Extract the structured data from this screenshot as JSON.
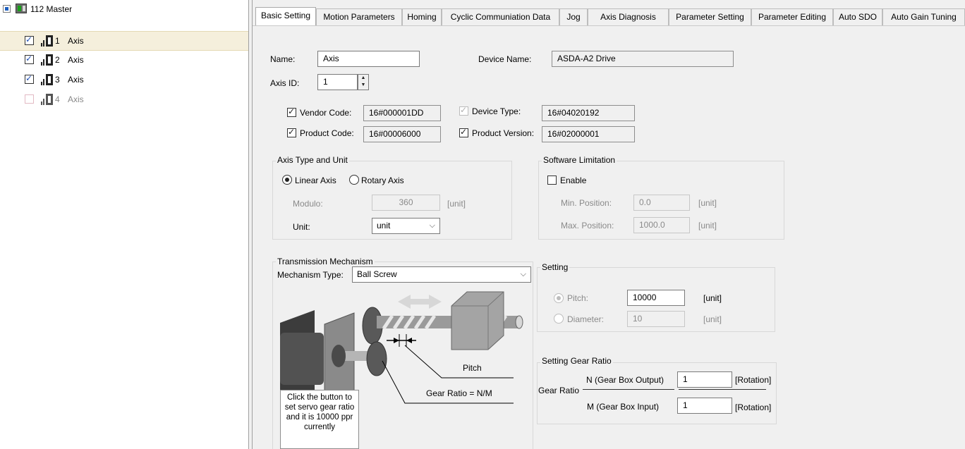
{
  "tree": {
    "master": {
      "label": "112 Master"
    },
    "axes": [
      {
        "num": "1",
        "label": "Axis",
        "checked": true,
        "selected": true,
        "enabled": true
      },
      {
        "num": "2",
        "label": "Axis",
        "checked": true,
        "selected": false,
        "enabled": true
      },
      {
        "num": "3",
        "label": "Axis",
        "checked": true,
        "selected": false,
        "enabled": true
      },
      {
        "num": "4",
        "label": "Axis",
        "checked": false,
        "selected": false,
        "enabled": false
      }
    ]
  },
  "tabs": [
    "Basic Setting",
    "Motion Parameters",
    "Homing",
    "Cyclic Communiation Data",
    "Jog",
    "Axis Diagnosis",
    "Parameter Setting",
    "Parameter Editing",
    "Auto SDO",
    "Auto Gain Tuning"
  ],
  "basic": {
    "name_label": "Name:",
    "name_value": "Axis",
    "device_name_label": "Device Name:",
    "device_name_value": "ASDA-A2 Drive",
    "axis_id_label": "Axis ID:",
    "axis_id_value": "1",
    "vendor_code_label": "Vendor Code:",
    "vendor_code_value": "16#000001DD",
    "device_type_label": "Device Type:",
    "device_type_value": "16#04020192",
    "product_code_label": "Product Code:",
    "product_code_value": "16#00006000",
    "product_version_label": "Product Version:",
    "product_version_value": "16#02000001"
  },
  "axis_type": {
    "title": "Axis Type and Unit",
    "linear_label": "Linear Axis",
    "rotary_label": "Rotary Axis",
    "selected": "linear",
    "modulo_label": "Modulo:",
    "modulo_value": "360",
    "modulo_unit": "[unit]",
    "unit_label": "Unit:",
    "unit_value": "unit"
  },
  "software_limit": {
    "title": "Software Limitation",
    "enable_label": "Enable",
    "enabled": false,
    "min_label": "Min. Position:",
    "min_value": "0.0",
    "min_unit": "[unit]",
    "max_label": "Max. Position:",
    "max_value": "1000.0",
    "max_unit": "[unit]"
  },
  "transmission": {
    "title": "Transmission Mechanism",
    "mech_type_label": "Mechanism Type:",
    "mech_type_value": "Ball Screw",
    "pitch_caption": "Pitch",
    "gear_ratio_caption": "Gear Ratio = N/M",
    "hint": "Click the button to set servo gear ratio and it is 10000 ppr currently"
  },
  "setting": {
    "title": "Setting",
    "pitch_label": "Pitch:",
    "pitch_value": "10000",
    "pitch_unit": "[unit]",
    "diameter_label": "Diameter:",
    "diameter_value": "10",
    "diameter_unit": "[unit]"
  },
  "gear_ratio": {
    "title": "Setting Gear Ratio",
    "label": "Gear Ratio",
    "n_label": "N (Gear Box Output)",
    "n_value": "1",
    "n_unit": "[Rotation]",
    "m_label": "M (Gear Box Input)",
    "m_value": "1",
    "m_unit": "[Rotation]"
  }
}
